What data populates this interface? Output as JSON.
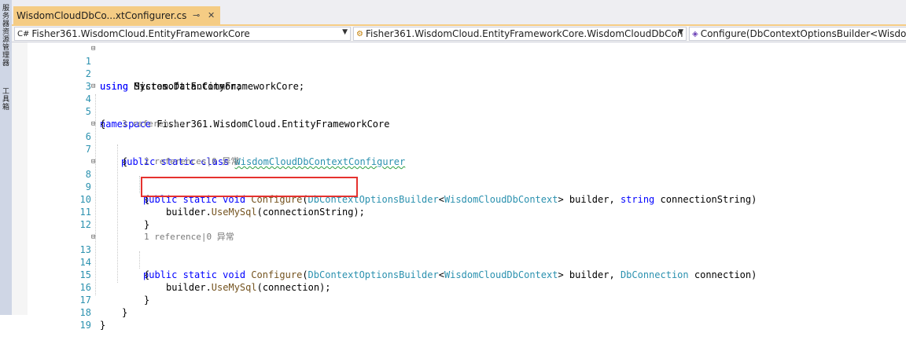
{
  "sidebar": {
    "items": [
      {
        "label": "服务器资源管理器"
      },
      {
        "label": "工具箱"
      }
    ]
  },
  "tab": {
    "title": "WisdomCloudDbCo...xtConfigurer.cs",
    "pin_icon": "pin-icon",
    "close_icon": "close-icon"
  },
  "navbar": {
    "project": "Fisher361.WisdomCloud.EntityFrameworkCore",
    "class": "Fisher361.WisdomCloud.EntityFrameworkCore.WisdomCloudDbCon",
    "member": "Configure(DbContextOptionsBuilder<WisdomCloudDbContext> builder, string connectionString)"
  },
  "code": {
    "lines": [
      {
        "n": "1",
        "using": "using",
        "text": " System.Data.Common;"
      },
      {
        "n": "2",
        "using": "using",
        "text": " Microsoft.EntityFrameworkCore;"
      },
      {
        "n": "3"
      },
      {
        "n": "4",
        "kw": "namespace",
        "text": " Fisher361.WisdomCloud.EntityFrameworkCore"
      },
      {
        "n": "5",
        "text": "{"
      },
      {
        "lens": "3 references"
      },
      {
        "n": "6",
        "kw": "public static class",
        "type": "WisdomCloudDbContextConfigurer"
      },
      {
        "n": "7",
        "text": "{"
      },
      {
        "lens": "2 references|0 异常"
      },
      {
        "n": "8",
        "kw1": "public static void",
        "fn": "Configure",
        "p1": "(",
        "t1": "DbContextOptionsBuilder",
        "p2": "<",
        "t2": "WisdomCloudDbContext",
        "p3": "> builder, ",
        "kw2": "string",
        "p4": " connectionString)"
      },
      {
        "n": "9",
        "text": "{"
      },
      {
        "n": "10",
        "obj": "builder.",
        "fn": "UseMySql",
        "rest": "(connectionString);"
      },
      {
        "n": "11",
        "text": "}"
      },
      {
        "n": "12"
      },
      {
        "lens": "1 reference|0 异常"
      },
      {
        "n": "13",
        "kw1": "public static void",
        "fn": "Configure",
        "p1": "(",
        "t1": "DbContextOptionsBuilder",
        "p2": "<",
        "t2": "WisdomCloudDbContext",
        "p3": "> builder, ",
        "t3": "DbConnection",
        "p4": " connection)"
      },
      {
        "n": "14",
        "text": "{"
      },
      {
        "n": "15",
        "obj": "builder.",
        "fn": "UseMySql",
        "rest": "(connection);"
      },
      {
        "n": "16",
        "text": "}"
      },
      {
        "n": "17",
        "text": "}"
      },
      {
        "n": "18",
        "text": "}"
      },
      {
        "n": "19"
      }
    ]
  }
}
